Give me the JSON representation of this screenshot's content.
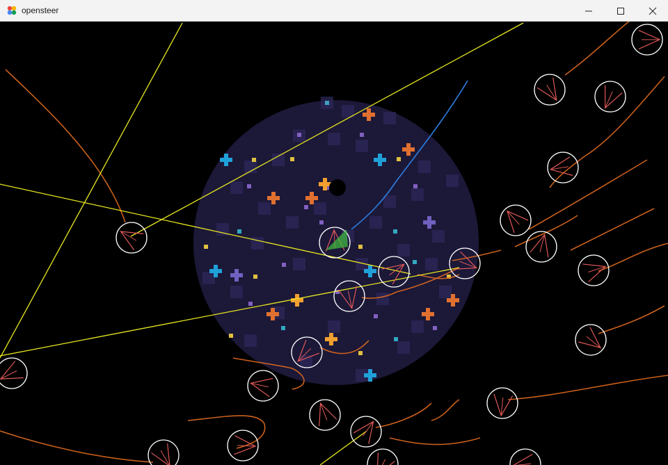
{
  "window": {
    "title": "opensteer",
    "icons": {
      "app": "opensteer-app-icon",
      "minimize": "minimize-icon",
      "maximize": "maximize-icon",
      "close": "close-icon"
    }
  },
  "scene": {
    "background_color": "#000000",
    "field_color": "#1c1838",
    "agent_ring_color": "#ffffff",
    "agent_spoke_color": "#e05858",
    "trail_color": "#e06a1e",
    "annotation_color": "#e8e820",
    "path_color": "#2b7ee0",
    "obstacle_color": "#000000"
  }
}
